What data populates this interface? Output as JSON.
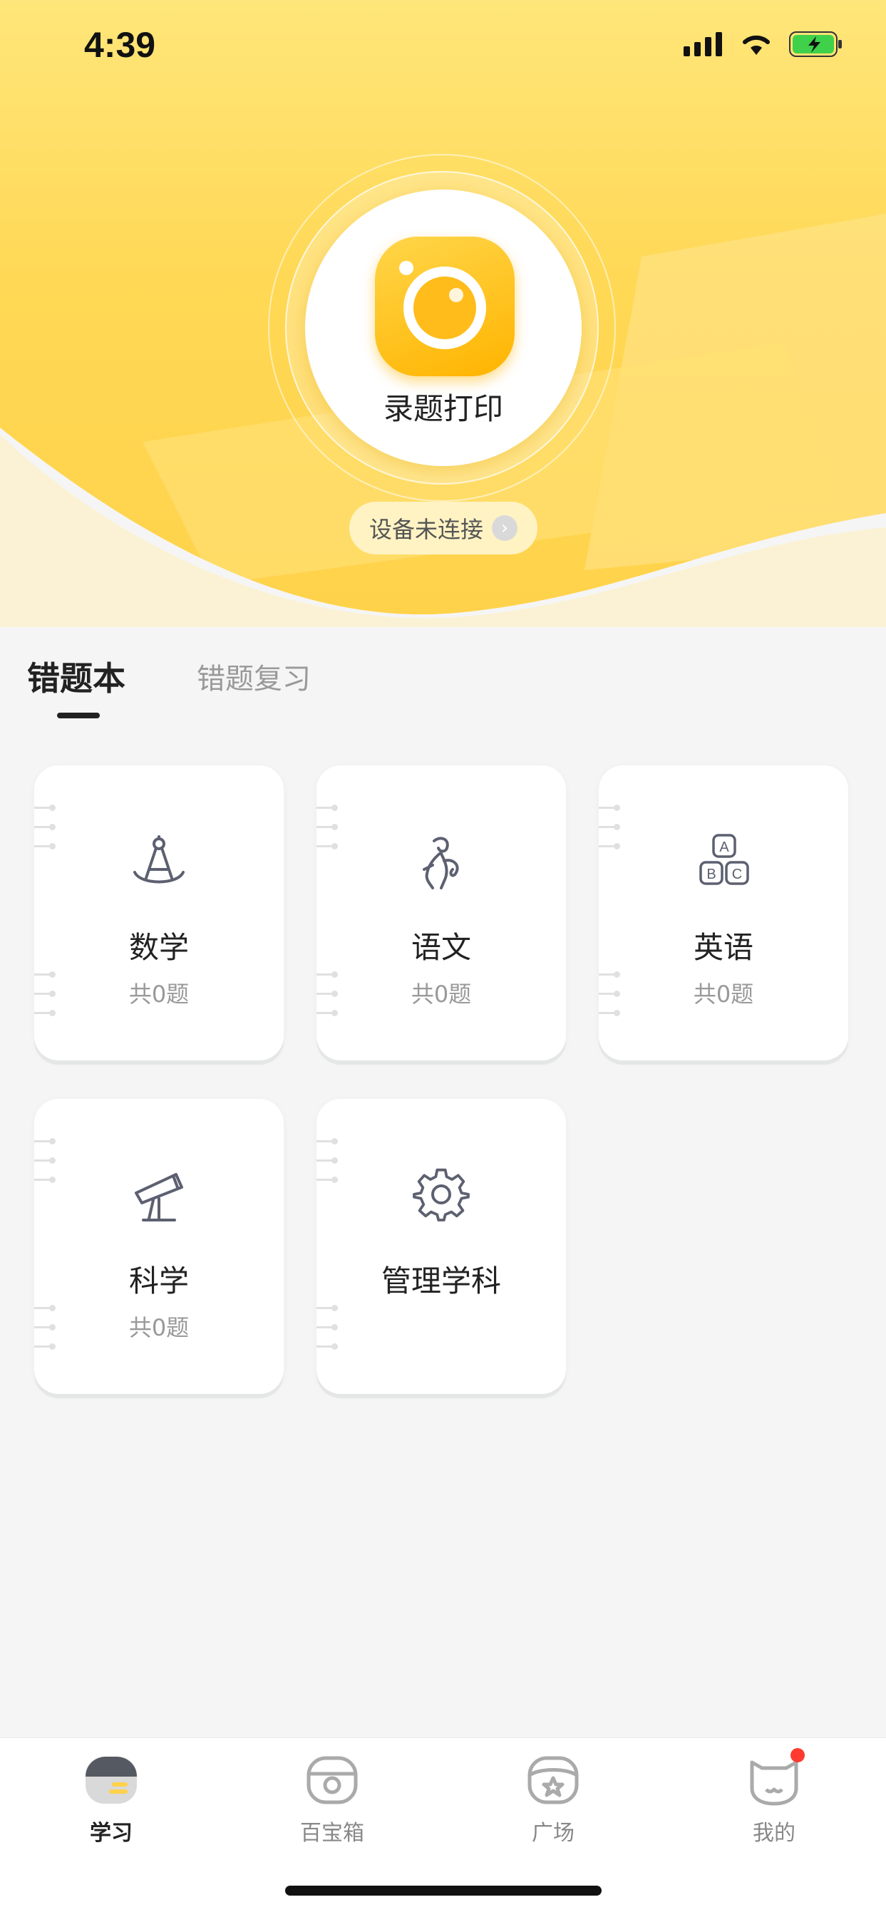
{
  "status_bar": {
    "time": "4:39"
  },
  "hero": {
    "capture_label": "录题打印",
    "device_status": "设备未连接",
    "accent_color": "#ffd24a"
  },
  "tabs": [
    {
      "label": "错题本",
      "active": true
    },
    {
      "label": "错题复习",
      "active": false
    }
  ],
  "subjects": [
    {
      "name": "数学",
      "count": "共0题",
      "icon": "compass-icon"
    },
    {
      "name": "语文",
      "count": "共0题",
      "icon": "quill-figure-icon"
    },
    {
      "name": "英语",
      "count": "共0题",
      "icon": "abc-blocks-icon"
    },
    {
      "name": "科学",
      "count": "共0题",
      "icon": "telescope-icon"
    },
    {
      "name": "管理学科",
      "count": "",
      "icon": "gear-icon"
    }
  ],
  "tabbar": [
    {
      "label": "学习",
      "icon": "study-icon",
      "active": true
    },
    {
      "label": "百宝箱",
      "icon": "toolbox-icon",
      "active": false
    },
    {
      "label": "广场",
      "icon": "plaza-icon",
      "active": false
    },
    {
      "label": "我的",
      "icon": "profile-cat-icon",
      "active": false,
      "badge": true
    }
  ]
}
